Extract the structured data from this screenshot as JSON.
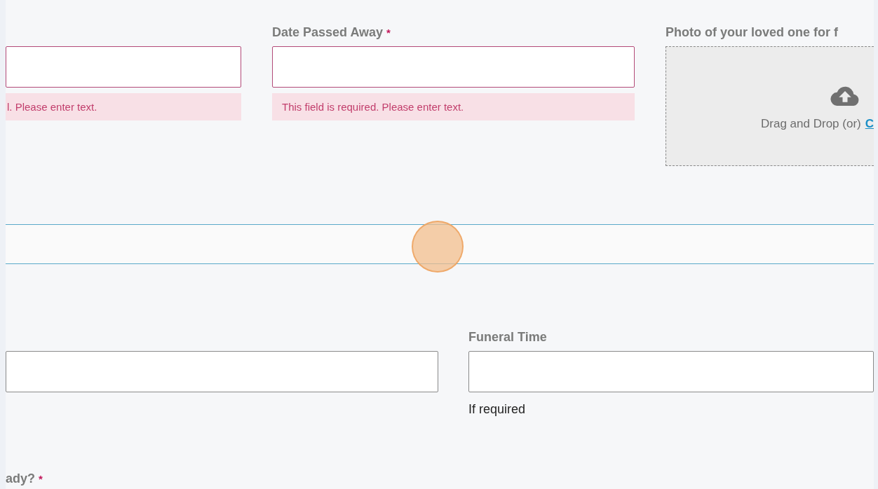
{
  "top_row": [
    {
      "kind": "text",
      "invalid": true,
      "error": "l. Please enter text."
    },
    {
      "kind": "text",
      "label": "Date Passed Away",
      "required_mark": "*",
      "invalid": true,
      "error": "This field is required. Please enter text."
    },
    {
      "kind": "upload",
      "label": "Photo of your loved one for f",
      "prompt": "Drag and Drop (or)",
      "link": "C"
    }
  ],
  "middle_row": [
    {
      "kind": "text",
      "invalid": false
    },
    {
      "kind": "text",
      "label": "Funeral Time",
      "invalid": false,
      "hint": "If required"
    }
  ],
  "bottom_question": {
    "label": "ady?",
    "required_mark": "*"
  }
}
